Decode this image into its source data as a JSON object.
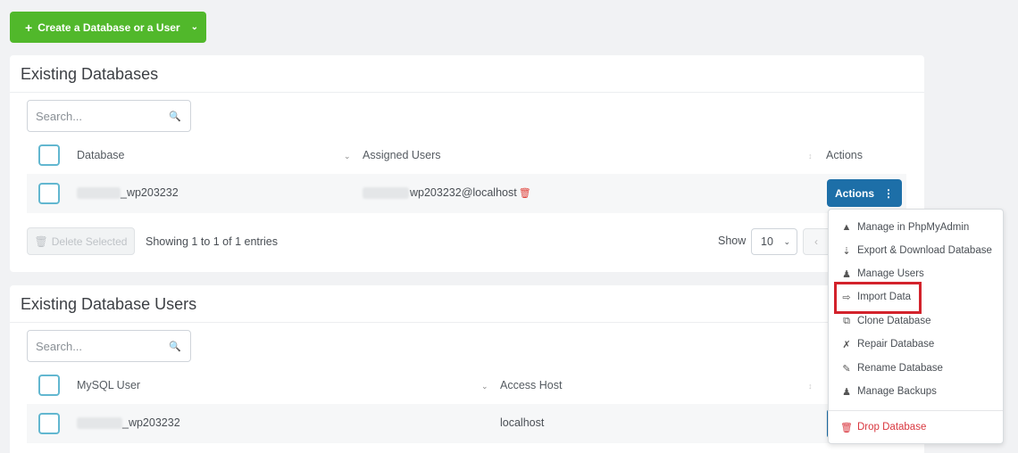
{
  "toolbar": {
    "create_label": "Create a Database or a User"
  },
  "databases": {
    "title": "Existing Databases",
    "search_placeholder": "Search...",
    "headers": {
      "database": "Database",
      "assigned_users": "Assigned Users",
      "actions": "Actions"
    },
    "rows": [
      {
        "name": "_wp203232",
        "user": "wp203232@localhost"
      }
    ],
    "actions_label": "Actions",
    "delete_label": "Delete Selected",
    "entries_text": "Showing 1 to 1 of 1 entries",
    "show_label": "Show",
    "page_size": "10"
  },
  "actions_menu": {
    "items": [
      {
        "label": "Manage in PhpMyAdmin",
        "icon": "phpmyadmin-icon"
      },
      {
        "label": "Export & Download Database",
        "icon": "export-icon"
      },
      {
        "label": "Manage Users",
        "icon": "users-icon"
      },
      {
        "label": "Import Data",
        "icon": "import-icon"
      },
      {
        "label": "Clone Database",
        "icon": "clone-icon"
      },
      {
        "label": "Repair Database",
        "icon": "wrench-icon"
      },
      {
        "label": "Rename Database",
        "icon": "pencil-icon"
      },
      {
        "label": "Manage Backups",
        "icon": "backup-icon"
      },
      {
        "label": "Drop Database",
        "icon": "trash-icon"
      }
    ]
  },
  "users": {
    "title": "Existing Database Users",
    "search_placeholder": "Search...",
    "headers": {
      "mysql_user": "MySQL User",
      "access_host": "Access Host"
    },
    "rows": [
      {
        "name": "_wp203232",
        "host": "localhost"
      }
    ]
  },
  "colors": {
    "create_green": "#51b82b",
    "action_blue": "#1d6fa8",
    "highlight_red": "#d3222b",
    "danger_red": "#d9363e"
  }
}
